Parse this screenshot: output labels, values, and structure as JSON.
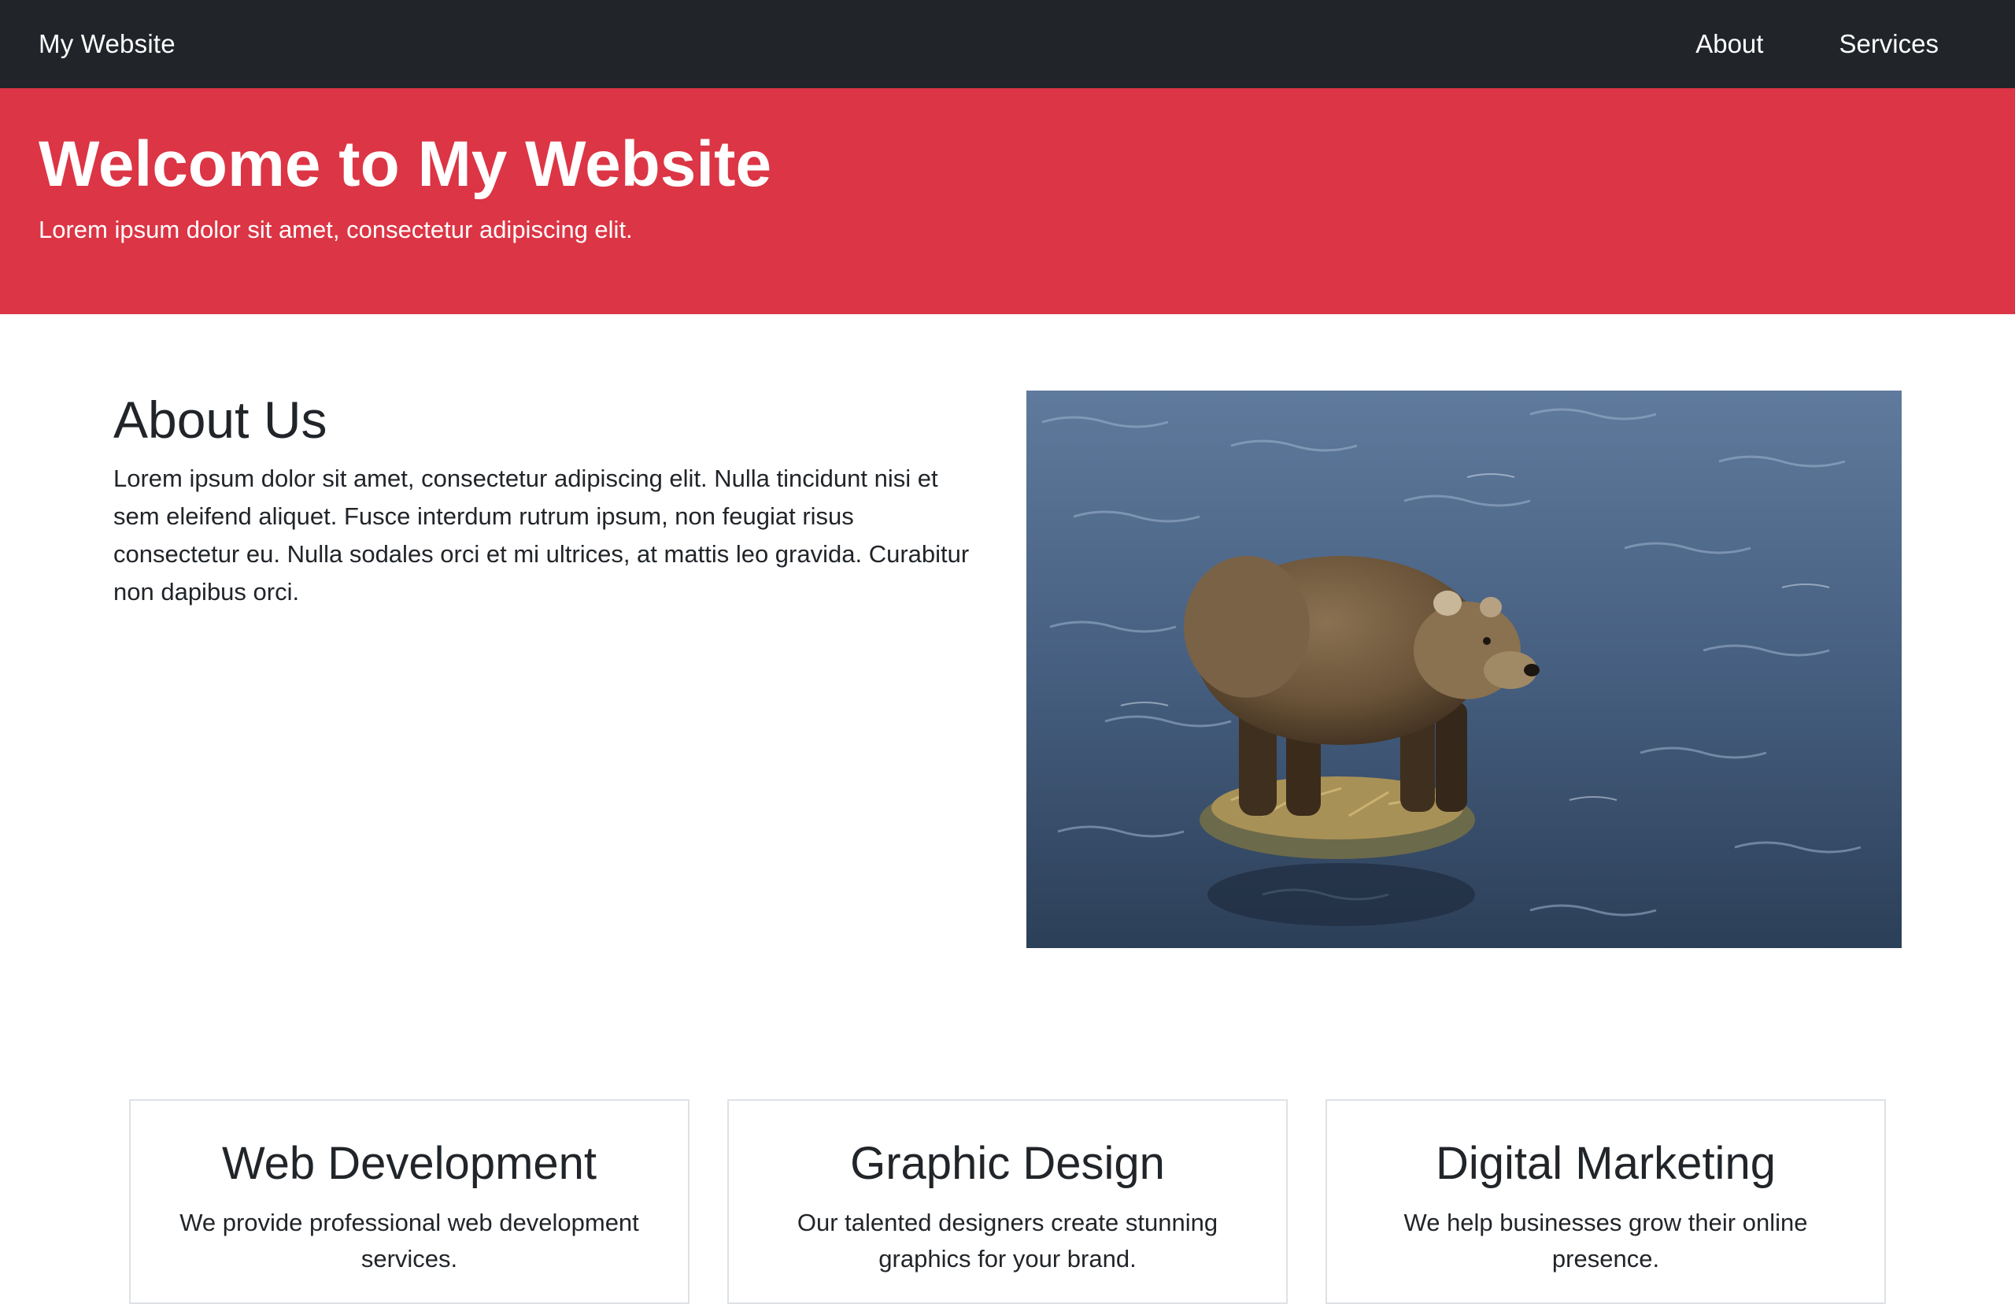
{
  "navbar": {
    "brand": "My Website",
    "links": [
      {
        "label": "About"
      },
      {
        "label": "Services"
      }
    ]
  },
  "hero": {
    "title": "Welcome to My Website",
    "subtitle": "Lorem ipsum dolor sit amet, consectetur adipiscing elit."
  },
  "about": {
    "heading": "About Us",
    "body": "Lorem ipsum dolor sit amet, consectetur adipiscing elit. Nulla tincidunt nisi et sem eleifend aliquet. Fusce interdum rutrum ipsum, non feugiat risus consectetur eu. Nulla sodales orci et mi ultrices, at mattis leo gravida. Curabitur non dapibus orci.",
    "image_subject": "brown-bear-in-river-photo"
  },
  "services": [
    {
      "title": "Web Development",
      "description": "We provide professional web development services."
    },
    {
      "title": "Graphic Design",
      "description": "Our talented designers create stunning graphics for your brand."
    },
    {
      "title": "Digital Marketing",
      "description": "We help businesses grow their online presence."
    }
  ],
  "colors": {
    "navbar_bg": "#212529",
    "hero_bg": "#dc3545",
    "text": "#212529",
    "card_border": "#dee2e6"
  }
}
